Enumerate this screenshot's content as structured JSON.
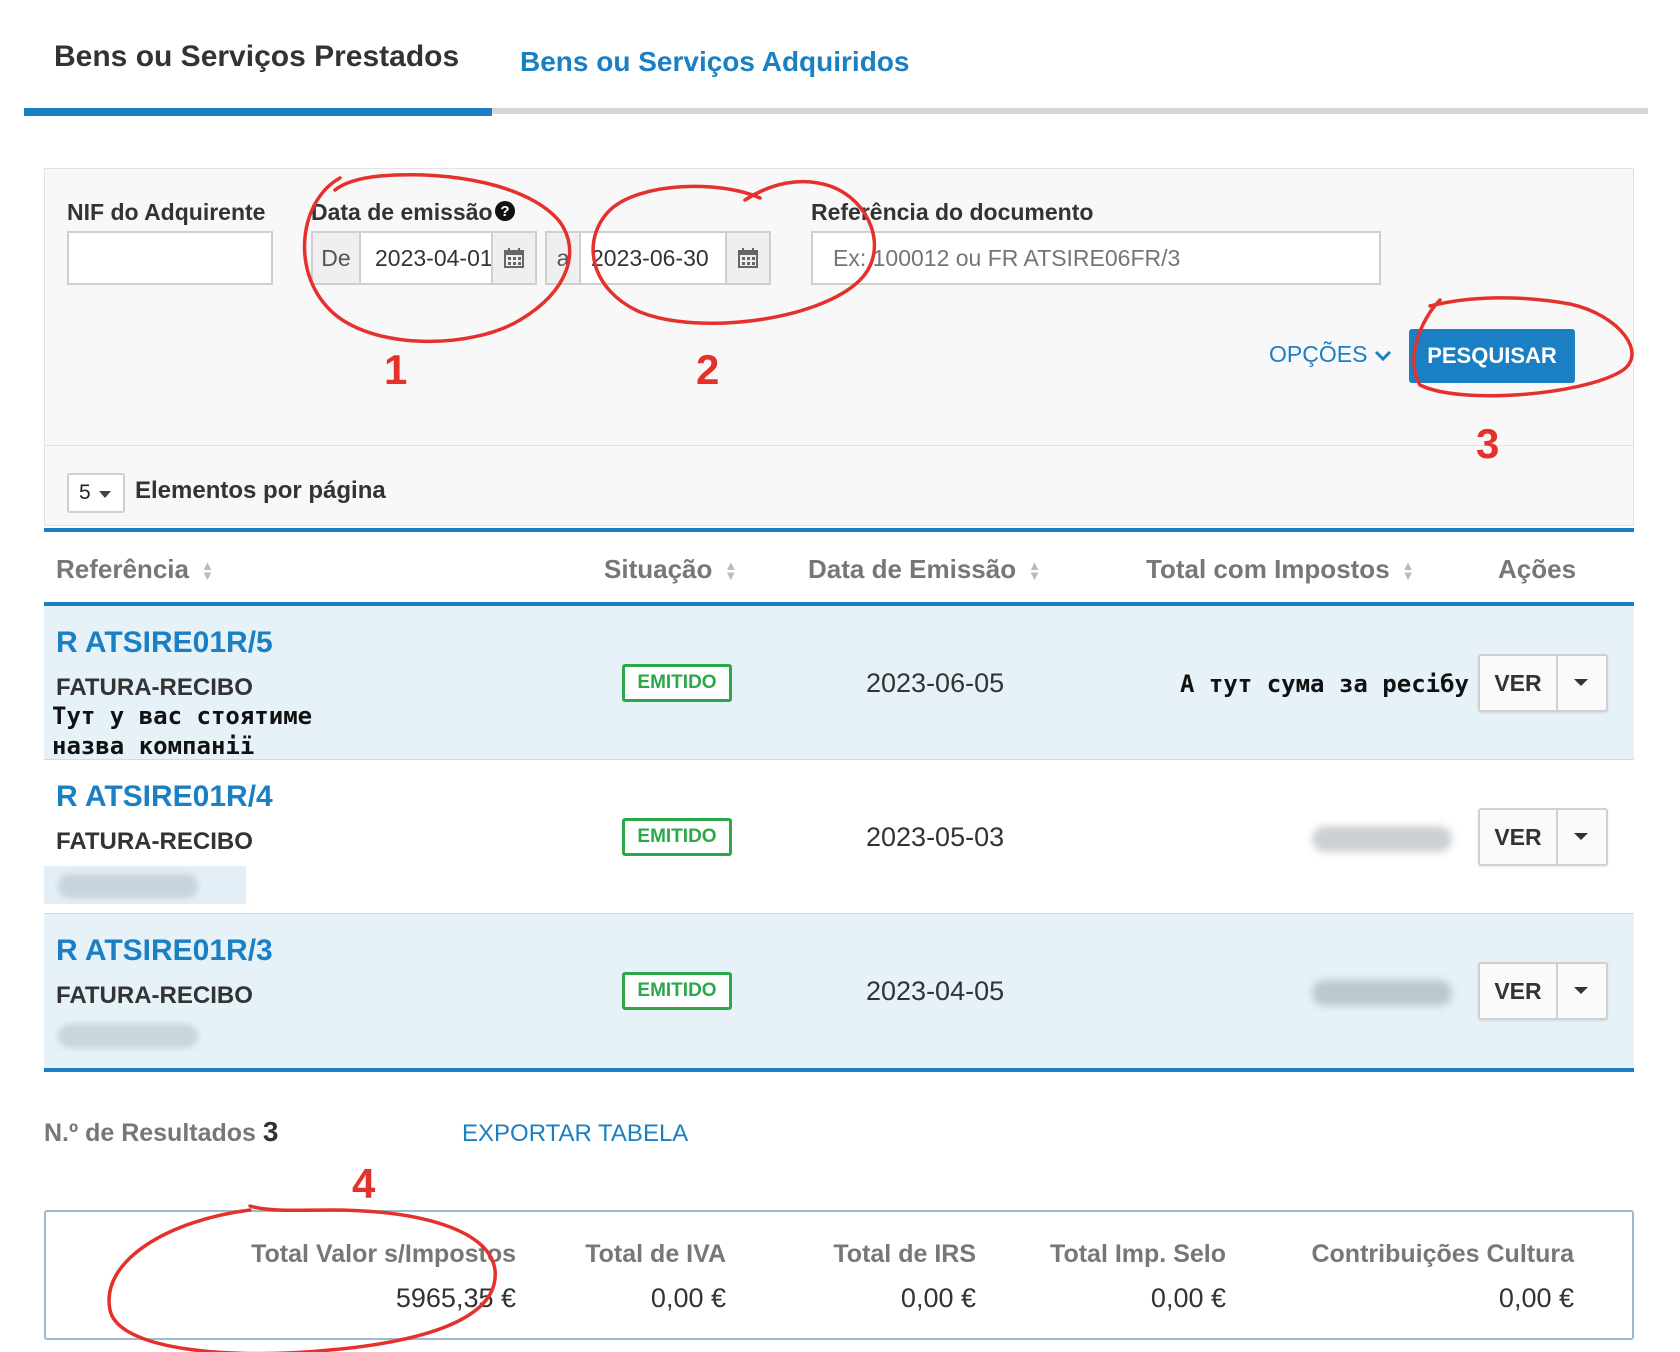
{
  "tabs": {
    "active": "Bens ou Serviços Prestados",
    "inactive": "Bens ou Serviços Adquiridos"
  },
  "filters": {
    "nif_label": "NIF do Adquirente",
    "nif_value": "",
    "date_label": "Data de emissão",
    "help_glyph": "?",
    "from_prefix": "De",
    "from_value": "2023-04-01",
    "to_prefix": "a",
    "to_value": "2023-06-30",
    "ref_label": "Referência do documento",
    "ref_placeholder": "Ex: 100012 ou FR ATSIRE06FR/3",
    "options_label": "OPÇÕES",
    "search_label": "PESQUISAR",
    "per_page_value": "5",
    "per_page_label": "Elementos por página"
  },
  "table": {
    "headers": [
      "Referência",
      "Situação",
      "Data de Emissão",
      "Total com Impostos",
      "Ações"
    ],
    "rows": [
      {
        "ref": "R ATSIRE01R/5",
        "type": "FATURA-RECIBO",
        "status": "EMITIDO",
        "date": "2023-06-05",
        "action": "VER"
      },
      {
        "ref": "R ATSIRE01R/4",
        "type": "FATURA-RECIBO",
        "status": "EMITIDO",
        "date": "2023-05-03",
        "action": "VER"
      },
      {
        "ref": "R ATSIRE01R/3",
        "type": "FATURA-RECIBO",
        "status": "EMITIDO",
        "date": "2023-04-05",
        "action": "VER"
      }
    ]
  },
  "annotations": {
    "company_note_line1": "Тут у вас стоятиме",
    "company_note_line2": "назва компанії",
    "amount_note": "А тут сума за ресібу",
    "n1": "1",
    "n2": "2",
    "n3": "3",
    "n4": "4",
    "color": "#e4312b"
  },
  "footer": {
    "results_label": "N.º de Resultados",
    "results_count": "3",
    "export_label": "EXPORTAR TABELA"
  },
  "totals": [
    {
      "label": "Total Valor s/Impostos",
      "value": "5965,35 €"
    },
    {
      "label": "Total de IVA",
      "value": "0,00 €"
    },
    {
      "label": "Total de IRS",
      "value": "0,00 €"
    },
    {
      "label": "Total Imp. Selo",
      "value": "0,00 €"
    },
    {
      "label": "Contribuições Cultura",
      "value": "0,00 €"
    }
  ]
}
